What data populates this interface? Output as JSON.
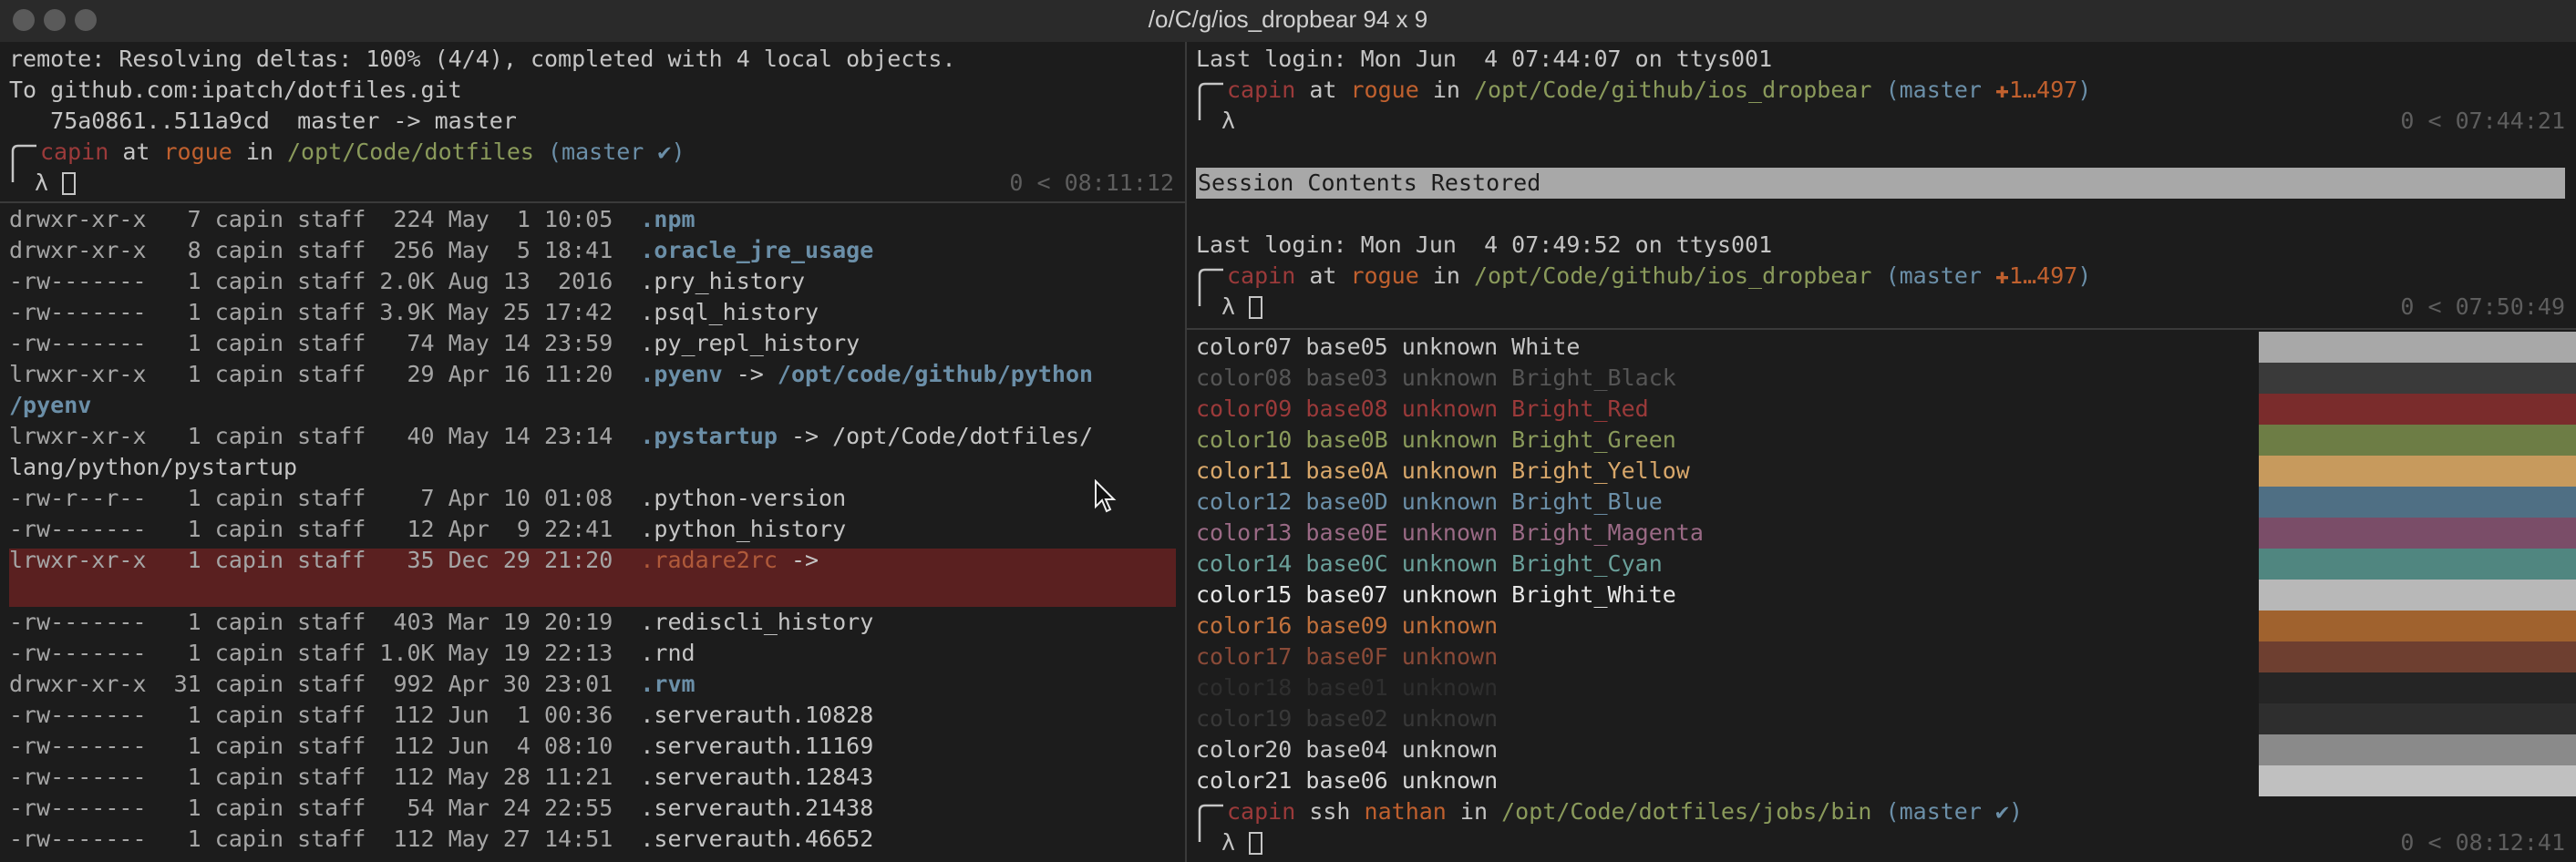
{
  "window": {
    "title": "/o/C/g/ios_dropbear 94 x 9"
  },
  "prompt_segments": {
    "user": "capin",
    "at": "at",
    "host": "rogue",
    "in": "in"
  },
  "left_top": {
    "git_lines": [
      "remote: Resolving deltas: 100% (4/4), completed with 4 local objects.",
      "To github.com:ipatch/dotfiles.git",
      "   75a0861..511a9cd  master -> master"
    ],
    "path": "/opt/Code/dotfiles",
    "branch": "(master ✔)",
    "status": "0 < 08:11:12",
    "lambda": "λ"
  },
  "listing": [
    {
      "perm": "drwxr-xr-x",
      "meta": "   7 capin staff  224 May  1 10:05  ",
      "name": ".npm",
      "color": "#6b8fa8",
      "bold": true
    },
    {
      "perm": "drwxr-xr-x",
      "meta": "   8 capin staff  256 May  5 18:41  ",
      "name": ".oracle_jre_usage",
      "color": "#6b8fa8",
      "bold": true
    },
    {
      "perm": "-rw-------",
      "meta": "   1 capin staff 2.0K Aug 13  2016  ",
      "name": ".pry_history",
      "color": "#c5c5c5",
      "bold": false
    },
    {
      "perm": "-rw-------",
      "meta": "   1 capin staff 3.9K May 25 17:42  ",
      "name": ".psql_history",
      "color": "#c5c5c5",
      "bold": false
    },
    {
      "perm": "-rw-------",
      "meta": "   1 capin staff   74 May 14 23:59  ",
      "name": ".py_repl_history",
      "color": "#c5c5c5",
      "bold": false
    },
    {
      "perm": "lrwxr-xr-x",
      "meta": "   1 capin staff   29 Apr 16 11:20  ",
      "name": ".pyenv",
      "color": "#6b8fa8",
      "bold": true,
      "arrow": " -> ",
      "target": "/opt/code/github/python",
      "target_color": "#6b8fa8",
      "target_bold": true,
      "wrap": "/pyenv",
      "wrap_color": "#6b8fa8"
    },
    {
      "perm": "lrwxr-xr-x",
      "meta": "   1 capin staff   40 May 14 23:14  ",
      "name": ".pystartup",
      "color": "#6b8fa8",
      "bold": true,
      "arrow": " -> ",
      "target": "/opt/Code/dotfiles/",
      "target_color": "#c5c5c5",
      "target_bold": false,
      "wrap": "lang/python/pystartup",
      "wrap_color": "#c5c5c5"
    },
    {
      "perm": "-rw-r--r--",
      "meta": "   1 capin staff    7 Apr 10 01:08  ",
      "name": ".python-version",
      "color": "#c5c5c5",
      "bold": false
    },
    {
      "perm": "-rw-------",
      "meta": "   1 capin staff   12 Apr  9 22:41  ",
      "name": ".python_history",
      "color": "#c5c5c5",
      "bold": false
    },
    {
      "perm": "lrwxr-xr-x",
      "meta": "   1 capin staff   35 Dec 29 21:20  ",
      "name": ".radare2rc",
      "color": "#b05a3a",
      "bold": false,
      "arrow": " -> ",
      "target": "",
      "target_color": "#c5c5c5",
      "target_bold": false,
      "broken": true
    },
    {
      "perm": "-rw-------",
      "meta": "   1 capin staff  403 Mar 19 20:19  ",
      "name": ".rediscli_history",
      "color": "#c5c5c5",
      "bold": false
    },
    {
      "perm": "-rw-------",
      "meta": "   1 capin staff 1.0K May 19 22:13  ",
      "name": ".rnd",
      "color": "#c5c5c5",
      "bold": false
    },
    {
      "perm": "drwxr-xr-x",
      "meta": "  31 capin staff  992 Apr 30 23:01  ",
      "name": ".rvm",
      "color": "#6b8fa8",
      "bold": true
    },
    {
      "perm": "-rw-------",
      "meta": "   1 capin staff  112 Jun  1 00:36  ",
      "name": ".serverauth.10828",
      "color": "#c5c5c5",
      "bold": false
    },
    {
      "perm": "-rw-------",
      "meta": "   1 capin staff  112 Jun  4 08:10  ",
      "name": ".serverauth.11169",
      "color": "#c5c5c5",
      "bold": false
    },
    {
      "perm": "-rw-------",
      "meta": "   1 capin staff  112 May 28 11:21  ",
      "name": ".serverauth.12843",
      "color": "#c5c5c5",
      "bold": false
    },
    {
      "perm": "-rw-------",
      "meta": "   1 capin staff   54 Mar 24 22:55  ",
      "name": ".serverauth.21438",
      "color": "#c5c5c5",
      "bold": false
    },
    {
      "perm": "-rw-------",
      "meta": "   1 capin staff  112 May 27 14:51  ",
      "name": ".serverauth.46652",
      "color": "#c5c5c5",
      "bold": false
    }
  ],
  "right_top": {
    "login1": "Last login: Mon Jun  4 07:44:07 on ttys001",
    "path": "/opt/Code/github/ios_dropbear",
    "branch_open": "(master ",
    "branch_mark": "✚1…497",
    "branch_close": ")",
    "status1": "0 < 07:44:21",
    "restored": "Session Contents Restored",
    "login2": "Last login: Mon Jun  4 07:49:52 on ttys001",
    "status2": "0 < 07:50:49",
    "lambda": "λ"
  },
  "colors": [
    {
      "label": "color07 base05 unknown White",
      "text": "#c5c5c5",
      "swatch": "#a8a8a8"
    },
    {
      "label": "color08 base03 unknown Bright_Black",
      "text": "#555555",
      "swatch": "#3a3a3a"
    },
    {
      "label": "color09 base08 unknown Bright_Red",
      "text": "#9b3a3a",
      "swatch": "#7a2c2c"
    },
    {
      "label": "color10 base0B unknown Bright_Green",
      "text": "#8a9a5b",
      "swatch": "#6d7d45"
    },
    {
      "label": "color11 base0A unknown Bright_Yellow",
      "text": "#d8a76a",
      "swatch": "#c79a5d"
    },
    {
      "label": "color12 base0D unknown Bright_Blue",
      "text": "#6b8fa8",
      "swatch": "#4f6f84"
    },
    {
      "label": "color13 base0E unknown Bright_Magenta",
      "text": "#9a6a85",
      "swatch": "#7a4d68"
    },
    {
      "label": "color14 base0C unknown Bright_Cyan",
      "text": "#6aa09a",
      "swatch": "#508680"
    },
    {
      "label": "color15 base07 unknown Bright_White",
      "text": "#e6e6e6",
      "swatch": "#b8b8b8"
    },
    {
      "label": "color16 base09 unknown",
      "text": "#c0703c",
      "swatch": "#a0622e"
    },
    {
      "label": "color17 base0F unknown",
      "text": "#8a4a38",
      "swatch": "#6e3f30"
    },
    {
      "label": "color18 base01 unknown",
      "text": "#2e2e2e",
      "swatch": "#252525"
    },
    {
      "label": "color19 base02 unknown",
      "text": "#383838",
      "swatch": "#2e2e2e"
    },
    {
      "label": "color20 base04 unknown",
      "text": "#c5c5c5",
      "swatch": "#8a8a8a"
    },
    {
      "label": "color21 base06 unknown",
      "text": "#d5d5d5",
      "swatch": "#c0c0c0"
    }
  ],
  "right_bottom": {
    "cmd": "ssh",
    "host": "nathan",
    "path": "/opt/Code/dotfiles/jobs/bin",
    "branch": "(master ✔)",
    "status": "0 < 08:12:41",
    "lambda": "λ"
  },
  "theme": {
    "user": "#9b3a3a",
    "host": "#c0602e",
    "path": "#8a9a5b",
    "branch": "#6b8fa8",
    "plus": "#c0602e"
  }
}
